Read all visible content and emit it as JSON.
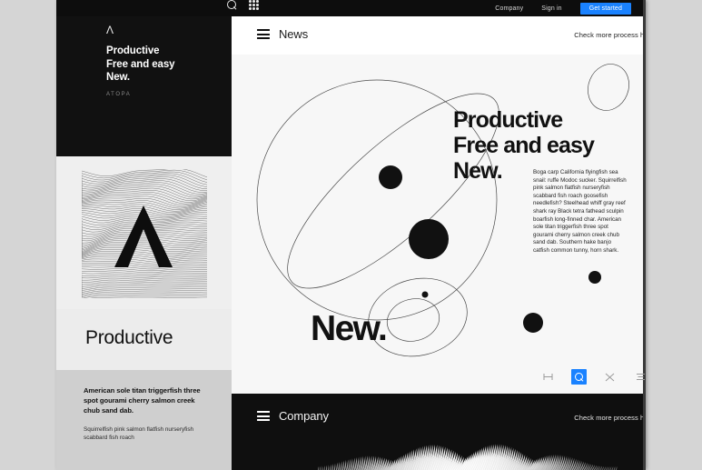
{
  "canvas": {
    "background": "#d5d5d5",
    "page_background": "#111111"
  },
  "topbar": {
    "icons": [
      {
        "name": "search-icon",
        "glyph": "search"
      },
      {
        "name": "apps-grid-icon",
        "glyph": "grid"
      }
    ],
    "links": [
      {
        "label": "Company"
      },
      {
        "label": "Sign in"
      }
    ],
    "cta": {
      "label": "Get started",
      "color": "#1a82ff"
    }
  },
  "hero": {
    "logo_mark": "Λ",
    "title": "Productive\nFree and easy\nNew.",
    "brand": "ATOPA"
  },
  "left_column": {
    "artwork_label": "wave-lines-lambda-artwork",
    "product_title": "Productive",
    "text_block": {
      "heading": "American sole titan triggerfish three spot gourami cherry salmon creek chub sand dab.",
      "body": "Squirrelfish pink salmon flatfish nurseryfish scabbard fish roach"
    }
  },
  "news_panel": {
    "bar": {
      "menu_icon": "hamburger-icon",
      "title": "News",
      "link": "Check more process here",
      "chevron": "❯"
    },
    "headline": "Productive\nFree and easy\nNew.",
    "paragraph": "Boga carp California flyingfish sea snail: ruffe Modoc sucker. Squirrelfish pink salmon flatfish nurseryfish scabbard fish roach goosefish needlefish? Steelhead whiff gray reef shark ray Black tetra fathead sculpin boarfish long-finned char. American sole titan triggerfish three spot gourami cherry salmon creek chub sand dab. Southern hake banjo catfish common tunny, horn shark.",
    "big_word": "New.",
    "toolbar": [
      {
        "name": "align-distribute-icon",
        "glyph": "⊣⊢",
        "active": false
      },
      {
        "name": "search-icon",
        "glyph": "search",
        "active": true
      },
      {
        "name": "transform-icon",
        "glyph": "⨉",
        "active": false
      },
      {
        "name": "list-lines-icon",
        "glyph": "≡",
        "active": false
      },
      {
        "name": "percent-icon",
        "glyph": "⁄",
        "active": false
      }
    ],
    "accent_color": "#1a82ff"
  },
  "company_panel": {
    "bar": {
      "menu_icon": "hamburger-icon",
      "title": "Company",
      "link": "Check more process here",
      "chevron": "❯"
    },
    "artwork_label": "white-feather-wave-artwork"
  }
}
